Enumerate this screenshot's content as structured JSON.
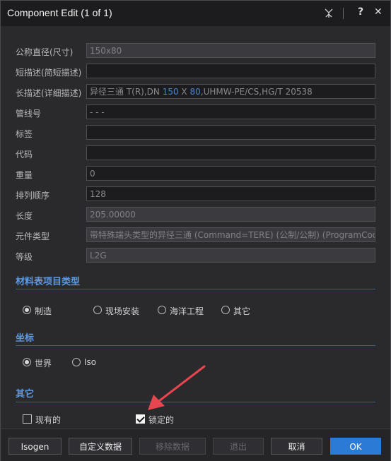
{
  "window": {
    "title": "Component Edit (1 of 1)",
    "help_label": "?",
    "close_label": "✕"
  },
  "fields": [
    {
      "label": "公称直径(尺寸)",
      "value": "150x80",
      "readonly": true
    },
    {
      "label": "短描述(简短描述)",
      "value": "",
      "readonly": false
    },
    {
      "label": "长描述(详细描述)",
      "value_parts": [
        "异径三通 T(R),DN ",
        "150",
        " X ",
        "80",
        ",UHMW-PE/CS,HG/T 20538"
      ],
      "readonly": false
    },
    {
      "label": "管线号",
      "value": "-   -   -",
      "readonly": false
    },
    {
      "label": "标签",
      "value": "",
      "readonly": false
    },
    {
      "label": "代码",
      "value": "",
      "readonly": false
    },
    {
      "label": "重量",
      "value": "0",
      "readonly": false
    },
    {
      "label": "排列顺序",
      "value": "128",
      "readonly": false
    },
    {
      "label": "长度",
      "value": "205.00000",
      "readonly": true
    },
    {
      "label": "元件类型",
      "value": "带特殊端头类型的异径三通 (Command=TERE) (公制/公制) (ProgramCode",
      "readonly": true
    },
    {
      "label": "等级",
      "value": "L2G",
      "readonly": true
    }
  ],
  "sections": {
    "bom_type": {
      "title": "材料表项目类型",
      "options": [
        "制造",
        "现场安装",
        "海洋工程",
        "其它"
      ],
      "selected": 0
    },
    "coords": {
      "title": "坐标",
      "options": [
        "世界",
        "Iso"
      ],
      "selected": 0
    },
    "other": {
      "title": "其它",
      "existing_label": "现有的",
      "existing_checked": false,
      "locked_label": "锁定的",
      "locked_checked": true
    }
  },
  "buttons": {
    "isogen": "Isogen",
    "custom_data": "自定义数据",
    "remove_data": "移除数据",
    "exit": "退出",
    "cancel": "取消",
    "ok": "OK"
  },
  "colors": {
    "accent": "#2b7bd6",
    "section": "#5d9ae2",
    "arrow": "#e8464f"
  }
}
